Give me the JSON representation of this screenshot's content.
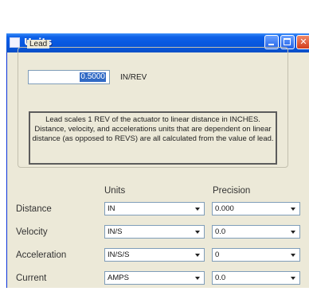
{
  "window": {
    "title": "Units"
  },
  "lead": {
    "group_label": "Lead",
    "value": "0.5000",
    "unit": "IN/REV",
    "info": "Lead scales 1 REV of the actuator to linear distance in INCHES. Distance, velocity, and accelerations units that are dependent on linear distance (as opposed to REVS) are all calculated from the value of lead."
  },
  "table": {
    "units_header": "Units",
    "precision_header": "Precision",
    "rows": [
      {
        "label": "Distance",
        "units": "IN",
        "precision": "0.000"
      },
      {
        "label": "Velocity",
        "units": "IN/S",
        "precision": "0.0"
      },
      {
        "label": "Acceleration",
        "units": "IN/S/S",
        "precision": "0"
      },
      {
        "label": "Current",
        "units": "AMPS",
        "precision": "0.0"
      }
    ]
  },
  "icons": {
    "title": "window-app-icon",
    "minimize": "minimize-icon",
    "maximize": "maximize-icon",
    "close": "close-icon",
    "dropdown": "chevron-down-icon"
  },
  "colors": {
    "titlebar": "#0858e0",
    "dialog": "#ece9d8",
    "selection": "#316ac5",
    "close": "#d23d1c"
  }
}
